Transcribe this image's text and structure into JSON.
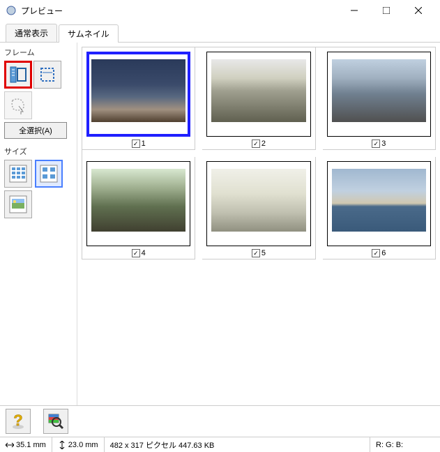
{
  "window": {
    "title": "プレビュー"
  },
  "tabs": {
    "normal": "通常表示",
    "thumbnail": "サムネイル"
  },
  "sidebar": {
    "frame_label": "フレーム",
    "select_all": "全選択(A)",
    "size_label": "サイズ"
  },
  "thumbnails": [
    {
      "num": "1",
      "checked": true,
      "selected": true,
      "cls": "t1"
    },
    {
      "num": "2",
      "checked": true,
      "selected": false,
      "cls": "t2"
    },
    {
      "num": "3",
      "checked": true,
      "selected": false,
      "cls": "t3"
    },
    {
      "num": "4",
      "checked": true,
      "selected": false,
      "cls": "t4"
    },
    {
      "num": "5",
      "checked": true,
      "selected": false,
      "cls": "t5"
    },
    {
      "num": "6",
      "checked": true,
      "selected": false,
      "cls": "t6"
    }
  ],
  "status": {
    "width_mm": "35.1 mm",
    "height_mm": "23.0 mm",
    "pixel_info": "482 x 317 ピクセル 447.63 KB",
    "rgb": "R:  G:  B:"
  }
}
